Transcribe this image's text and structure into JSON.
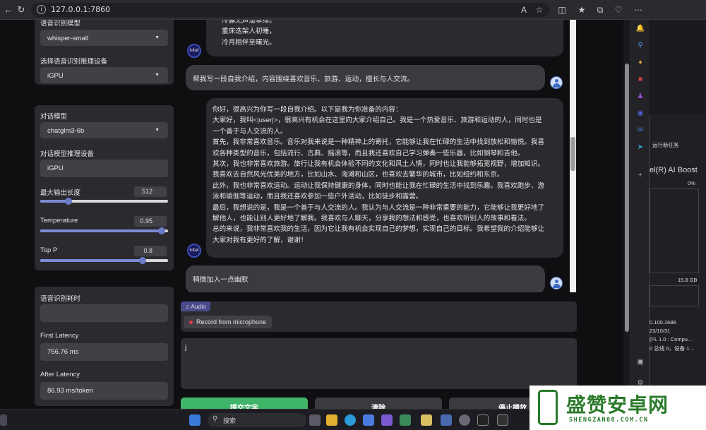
{
  "browser": {
    "url": "127.0.0.1:7860"
  },
  "settings_panel_1": {
    "asr_model_label": "语音识别模型",
    "asr_model_value": "whisper-small",
    "asr_device_label": "选择语音识别推理设备",
    "asr_device_value": "iGPU"
  },
  "settings_panel_2": {
    "chat_model_label": "对话模型",
    "chat_model_value": "chatglm3-6b",
    "chat_device_label": "对话模型推理设备",
    "chat_device_value": "iGPU",
    "max_len_label": "最大输出长度",
    "max_len_value": "512",
    "max_len_fraction": 0.22,
    "temperature_label": "Temperature",
    "temperature_value": "0.95",
    "temperature_fraction": 0.95,
    "top_p_label": "Top P",
    "top_p_value": "0.8",
    "top_p_fraction": 0.8
  },
  "metrics_panel": {
    "asr_time_label": "语音识别耗时",
    "asr_time_value": "",
    "first_latency_label": "First Latency",
    "first_latency_value": "756.76 ms",
    "after_latency_label": "After Latency",
    "after_latency_value": "86.93 ms/token"
  },
  "chat": {
    "bot_avatar_text": "intel",
    "msg1_lines": [
      "冷露无声湿草绿。",
      "重床迭架人初睡，",
      "冷月相伴至曙光。"
    ],
    "user_msg1": "帮我写一段自我介绍，内容围绕喜欢音乐、旅游、运动，擅长与人交流。",
    "msg2_lines": [
      "你好，很高兴为你写一段自我介绍。以下是我为你准备的内容：",
      "大家好，我叫<|user|>，很高兴有机会在这里向大家介绍自己。我是一个热爱音乐、旅游和运动的人，同时也是",
      "一个善于与人交流的人。",
      "首先，我非常喜欢音乐。音乐对我来说是一种精神上的寄托，它能够让我在忙碌的生活中找到放松和愉悦。我喜",
      "欢各种类型的音乐，包括流行、古典、摇滚等，而且我还喜欢自己学习弹奏一些乐器，比如钢琴和吉他。",
      "其次，我也非常喜欢旅游。旅行让我有机会体验不同的文化和风土人情，同时也让我能够拓宽视野，增加知识。",
      "我喜欢去自然风光优美的地方，比如山水、海滩和山区，也喜欢去繁华的城市，比如纽约和东京。",
      "此外，我也非常喜欢运动。运动让我保持健康的身体，同时也能让我在忙碌的生活中找到乐趣。我喜欢跑步、游",
      "泳和瑜伽等运动，而且我还喜欢参加一些户外活动，比如徒步和露营。",
      "最后，我想说的是，我是一个善于与人交流的人。我认为与人交流是一种非常重要的能力，它能够让我更好地了",
      "解他人，也能让别人更好地了解我。我喜欢与人聊天，分享我的想法和感受，也喜欢听别人的故事和看法。",
      "总的来说，我非常喜欢我的生活，因为它让我有机会实现自己的梦想，实现自己的目标。我希望我的介绍能够让",
      "大家对我有更好的了解，谢谢！"
    ],
    "user_msg2": "稍微加入一点幽默"
  },
  "audio": {
    "tag_label": "Audio",
    "record_label": "Record from microphone"
  },
  "text_input": {
    "value": "j"
  },
  "buttons": {
    "submit_label": "提交文字",
    "clear_label": "清除",
    "stop_label": "停止播放"
  },
  "task_manager": {
    "tab_label": "运行新任务",
    "gpu_title": "el(R) AI Boost",
    "pct": "0%",
    "mem": "15.8 GB",
    "driver": "0.100.1688",
    "date": "23/10/31",
    "fl": "(FL 1.0 : Compu…",
    "bus": "0 总线 0，设备 1…"
  },
  "taskbar": {
    "search_placeholder": "搜索"
  },
  "watermark": {
    "title": "盛赞安卓网",
    "subtitle": "SHENGZAN08.COM.CN"
  },
  "colors": {
    "accent": "#6a7bc8",
    "submit": "#3fb56a",
    "panel": "#2b2b2f",
    "watermark_green": "#2a7a2a"
  }
}
